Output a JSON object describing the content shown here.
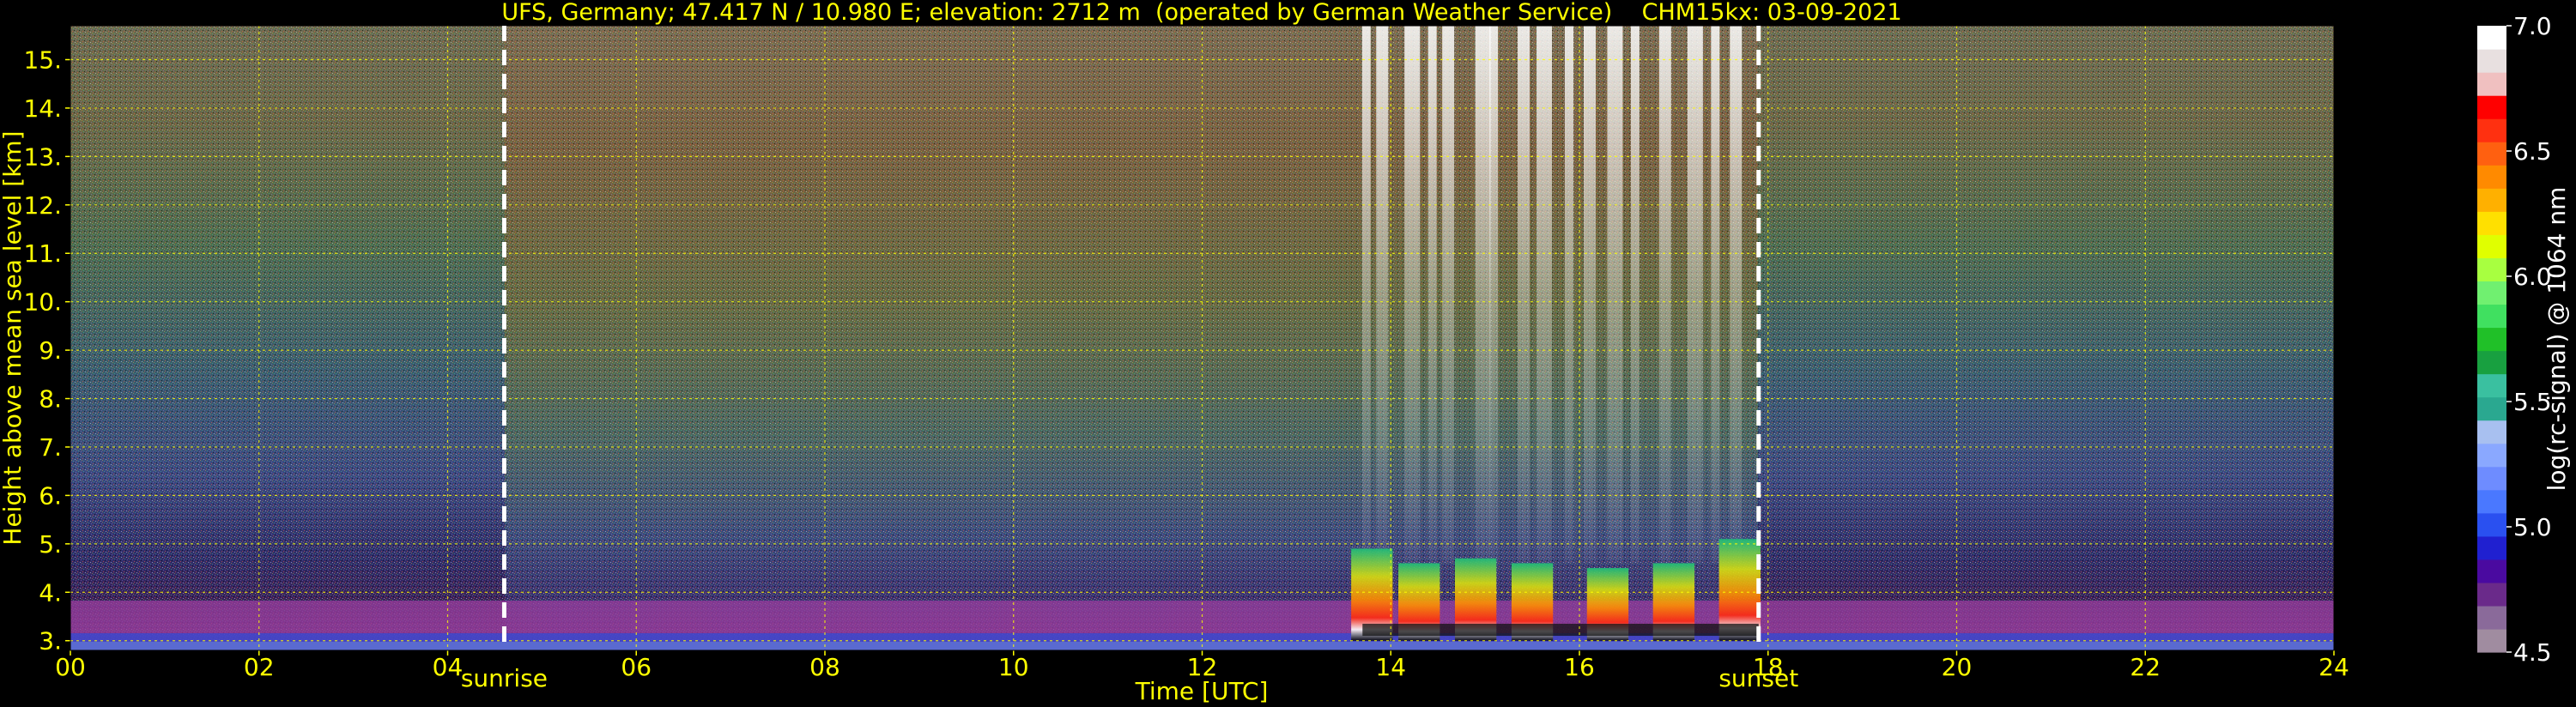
{
  "chart_data": {
    "type": "heatmap",
    "title": "UFS, Germany; 47.417 N / 10.980 E; elevation: 2712 m  (operated by German Weather Service)    CHM15kx: 03-09-2021",
    "xlabel": "Time [UTC]",
    "ylabel": "Height above mean sea level [km]",
    "x_ticks": [
      "00",
      "02",
      "04",
      "06",
      "08",
      "10",
      "12",
      "14",
      "16",
      "18",
      "20",
      "22",
      "24"
    ],
    "y_ticks": [
      "3.",
      "4.",
      "5.",
      "6.",
      "7.",
      "8.",
      "9.",
      "10.",
      "11.",
      "12.",
      "13.",
      "14.",
      "15."
    ],
    "xlim": [
      0,
      24
    ],
    "ylim": [
      2.8,
      15.7
    ],
    "grid": true,
    "annotations": [
      {
        "text": "sunrise",
        "x": 4.6
      },
      {
        "text": "sunset",
        "x": 17.9
      }
    ],
    "colorbar": {
      "label": "log(rc-signal) @ 1064 nm",
      "ticks": [
        "4.5",
        "5.0",
        "5.5",
        "6.0",
        "6.5",
        "7.0"
      ],
      "range": [
        4.5,
        7.0
      ]
    },
    "cloud_columns": [
      {
        "x": 13.8,
        "top_km": 4.9
      },
      {
        "x": 14.3,
        "top_km": 4.6
      },
      {
        "x": 14.9,
        "top_km": 4.7
      },
      {
        "x": 15.5,
        "top_km": 4.6
      },
      {
        "x": 16.3,
        "top_km": 4.5
      },
      {
        "x": 17.0,
        "top_km": 4.6
      },
      {
        "x": 17.7,
        "top_km": 5.1
      }
    ]
  },
  "colors": {
    "text": "#ffff00",
    "grid": "#ffff00",
    "background": "#000000",
    "colorbar_label": "#ffffff"
  }
}
